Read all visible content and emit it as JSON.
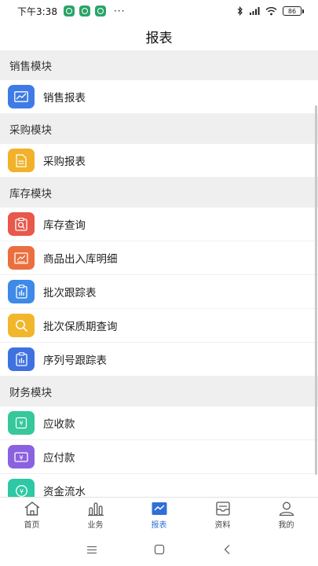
{
  "status_bar": {
    "time": "下午3:38",
    "dots": "···",
    "battery": "86"
  },
  "header": {
    "title": "报表"
  },
  "sections": [
    {
      "title": "销售模块",
      "items": [
        {
          "label": "销售报表",
          "icon": "line-chart-icon",
          "color": "#3f7be6"
        }
      ]
    },
    {
      "title": "采购模块",
      "items": [
        {
          "label": "采购报表",
          "icon": "document-icon",
          "color": "#f1b12a"
        }
      ]
    },
    {
      "title": "库存模块",
      "items": [
        {
          "label": "库存查询",
          "icon": "inventory-search-icon",
          "color": "#e8584b"
        },
        {
          "label": "商品出入库明细",
          "icon": "in-out-detail-icon",
          "color": "#eb6f3e"
        },
        {
          "label": "批次跟踪表",
          "icon": "clipboard-chart-icon",
          "color": "#3d8ae8"
        },
        {
          "label": "批次保质期查询",
          "icon": "search-icon",
          "color": "#f2b62a"
        },
        {
          "label": "序列号跟踪表",
          "icon": "clipboard-chart-icon",
          "color": "#3f72e0"
        }
      ]
    },
    {
      "title": "财务模块",
      "items": [
        {
          "label": "应收款",
          "icon": "receivable-icon",
          "color": "#36c79a"
        },
        {
          "label": "应付款",
          "icon": "payable-icon",
          "color": "#8a62e0"
        },
        {
          "label": "资金流水",
          "icon": "cash-flow-icon",
          "color": "#2ec8a5"
        }
      ]
    }
  ],
  "tabs": [
    {
      "label": "首页",
      "icon": "home-icon"
    },
    {
      "label": "业务",
      "icon": "bar-chart-icon"
    },
    {
      "label": "报表",
      "icon": "report-icon",
      "active": true
    },
    {
      "label": "资料",
      "icon": "data-icon"
    },
    {
      "label": "我的",
      "icon": "user-icon"
    }
  ],
  "colors": {
    "accent": "#2f6fd6",
    "section_bg": "#efefef"
  }
}
